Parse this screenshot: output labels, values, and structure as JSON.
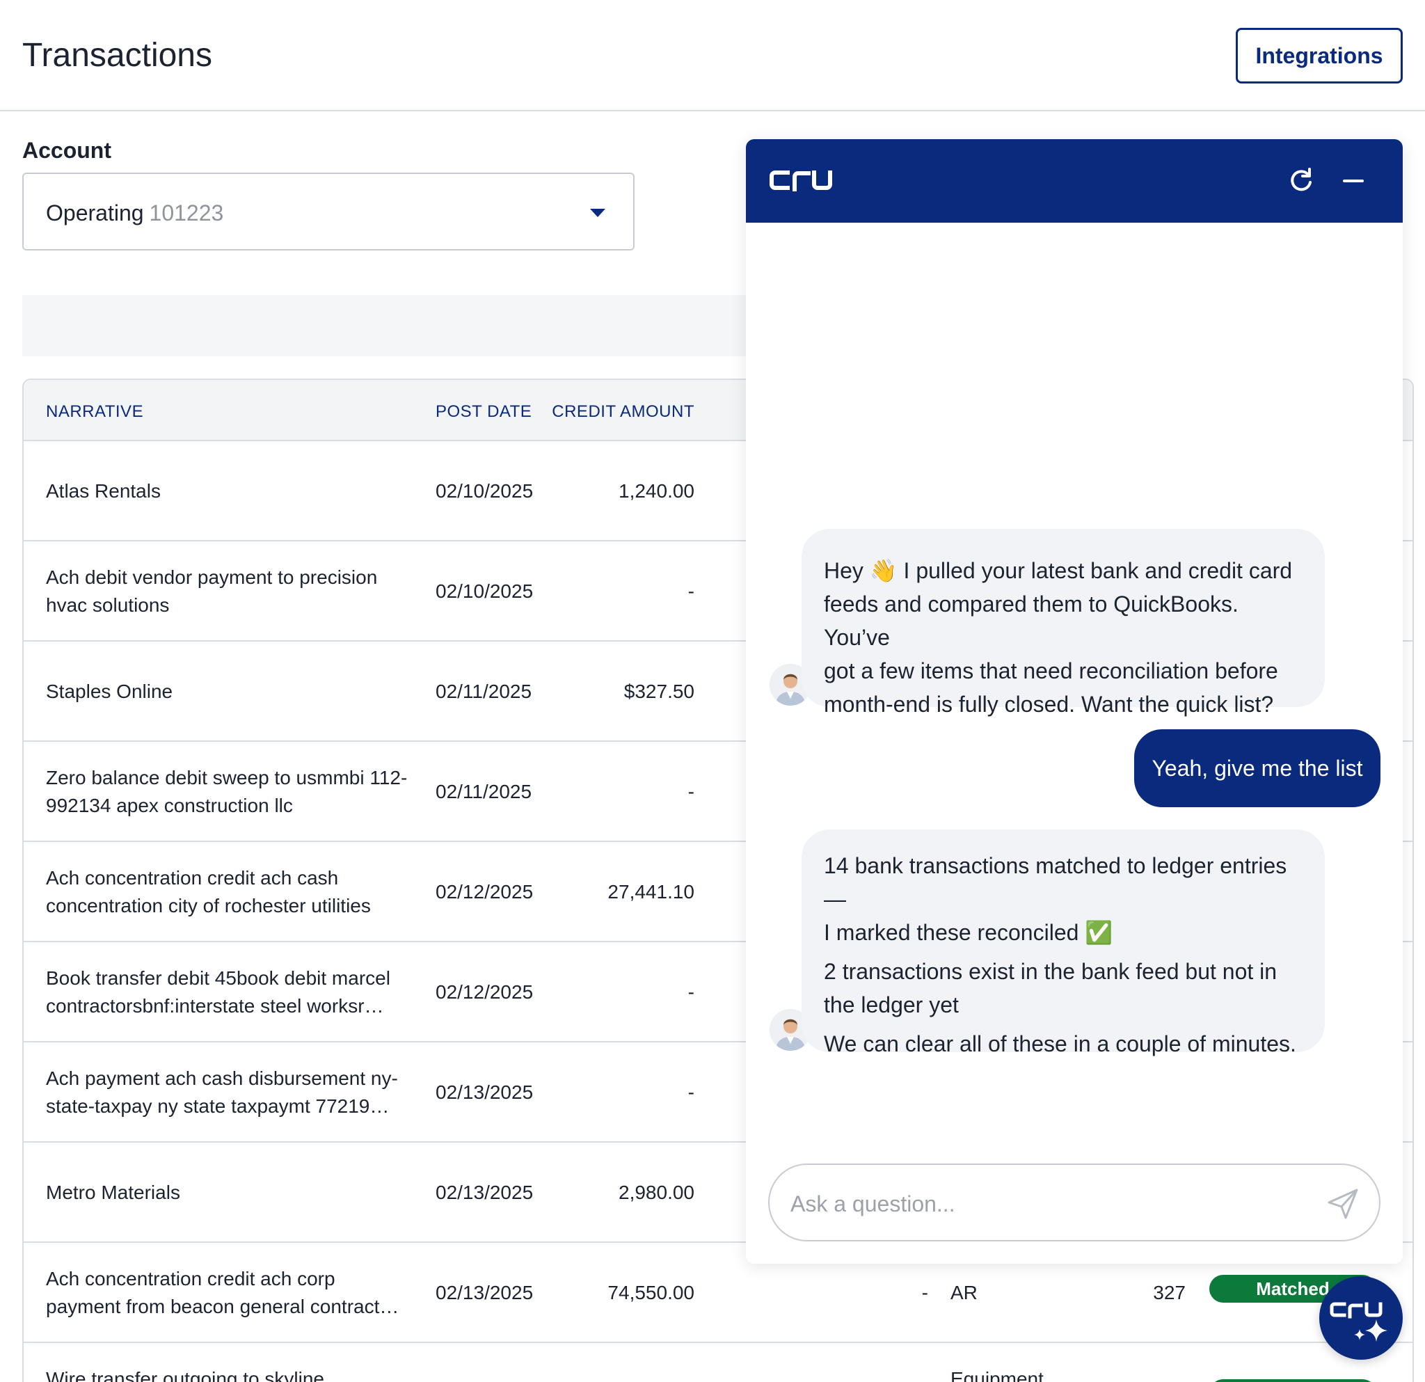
{
  "header": {
    "title": "Transactions",
    "integrations_label": "Integrations"
  },
  "account": {
    "label": "Account",
    "selected_name": "Operating",
    "selected_number": "101223"
  },
  "table": {
    "columns": {
      "narrative": "NARRATIVE",
      "post_date": "POST DATE",
      "credit_amount": "CREDIT AMOUNT"
    },
    "rows": [
      {
        "narrative": "Atlas Rentals",
        "post_date": "02/10/2025",
        "credit_amount": "1,240.00"
      },
      {
        "narrative": "Ach debit vendor payment to precision hvac solutions",
        "post_date": "02/10/2025",
        "credit_amount": "-"
      },
      {
        "narrative": "Staples Online",
        "post_date": "02/11/2025",
        "credit_amount": "$327.50"
      },
      {
        "narrative": "Zero balance debit sweep to usmmbi 112-992134 apex construction llc",
        "post_date": "02/11/2025",
        "credit_amount": "-"
      },
      {
        "narrative": "Ach concentration credit ach cash concentration city of rochester utilities",
        "post_date": "02/12/2025",
        "credit_amount": "27,441.10"
      },
      {
        "narrative": "Book transfer debit 45book debit marcel contractorsbnf:interstate steel worksr…",
        "post_date": "02/12/2025",
        "credit_amount": "-"
      },
      {
        "narrative": "Ach payment ach cash disbursement ny-state-taxpay ny state taxpaymt 77219…",
        "post_date": "02/13/2025",
        "credit_amount": "-"
      },
      {
        "narrative": "Metro Materials",
        "post_date": "02/13/2025",
        "credit_amount": "2,980.00"
      },
      {
        "narrative": "Ach concentration credit ach corp payment from beacon general contract…",
        "post_date": "02/13/2025",
        "credit_amount": "74,550.00",
        "debit_amount": "-",
        "gl": "AR",
        "ref": "327",
        "status": "Matched"
      },
      {
        "narrative": "Wire transfer outgoing to skyline",
        "gl": "Equipment"
      }
    ]
  },
  "chat": {
    "brand": "cru",
    "messages": [
      {
        "role": "assistant",
        "line1": "Hey",
        "emoji1": "👋",
        "line1b": " I pulled your latest bank and credit card",
        "line2": "feeds and compared them to QuickBooks. You’ve",
        "line3": "got a few items that need reconciliation before",
        "line4": "month-end is fully closed. Want the quick list?"
      },
      {
        "role": "user",
        "text": "Yeah, give me the list"
      },
      {
        "role": "assistant",
        "p1a": "14 bank transactions matched to ledger entries —",
        "p1b": "I marked these reconciled",
        "p1emoji": "✅",
        "p2a": "2 transactions exist in the bank feed but not in",
        "p2b": "the ledger yet",
        "p3": "We can clear all of these in a couple of minutes."
      }
    ],
    "input_placeholder": "Ask a question..."
  },
  "colors": {
    "brand_navy": "#0a2a7e",
    "matched_green": "#0b7a3b",
    "bubble_gray": "#f2f3f6"
  }
}
